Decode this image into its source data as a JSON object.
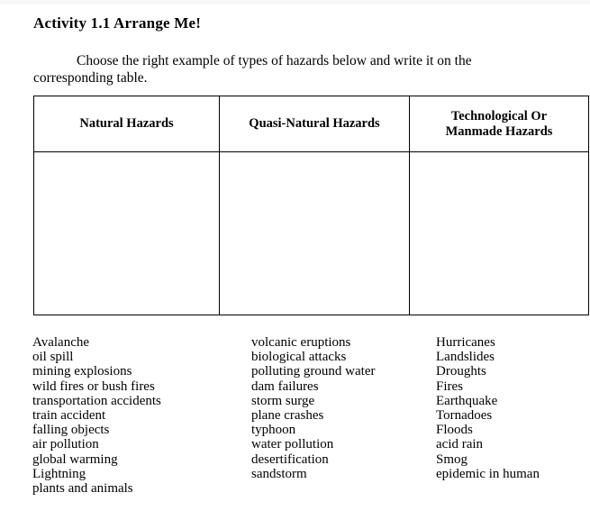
{
  "document": {
    "title": "Activity 1.1 Arrange Me!",
    "instructions": "Choose the right example of types of hazards below and write it on the corresponding table."
  },
  "table": {
    "headers": [
      "Natural Hazards",
      "Quasi-Natural Hazards",
      "Technological Or Manmade Hazards"
    ],
    "header_lines": {
      "col1": "Natural Hazards",
      "col2": "Quasi-Natural Hazards",
      "col3_line1": "Technological Or",
      "col3_line2": "Manmade Hazards"
    },
    "body_cells": [
      "",
      "",
      ""
    ]
  },
  "word_bank": {
    "column1": [
      "Avalanche",
      "oil spill",
      "mining explosions",
      "wild fires or bush fires",
      "transportation accidents",
      "train accident",
      "falling objects",
      "air pollution",
      "global warming",
      "Lightning",
      "plants and animals"
    ],
    "column2": [
      "volcanic eruptions",
      "biological attacks",
      "polluting ground water",
      "dam failures",
      "storm surge",
      "plane crashes",
      "typhoon",
      "water pollution",
      "desertification",
      "sandstorm"
    ],
    "column3": [
      "Hurricanes",
      "Landslides",
      "Droughts",
      "Fires",
      "Earthquake",
      "Tornadoes",
      "Floods",
      "acid rain",
      "Smog",
      "epidemic in human"
    ]
  },
  "colors": {
    "page_background": "#ffffff",
    "text": "#000000",
    "table_border": "#000000",
    "top_strip": "#f7f7f8"
  }
}
